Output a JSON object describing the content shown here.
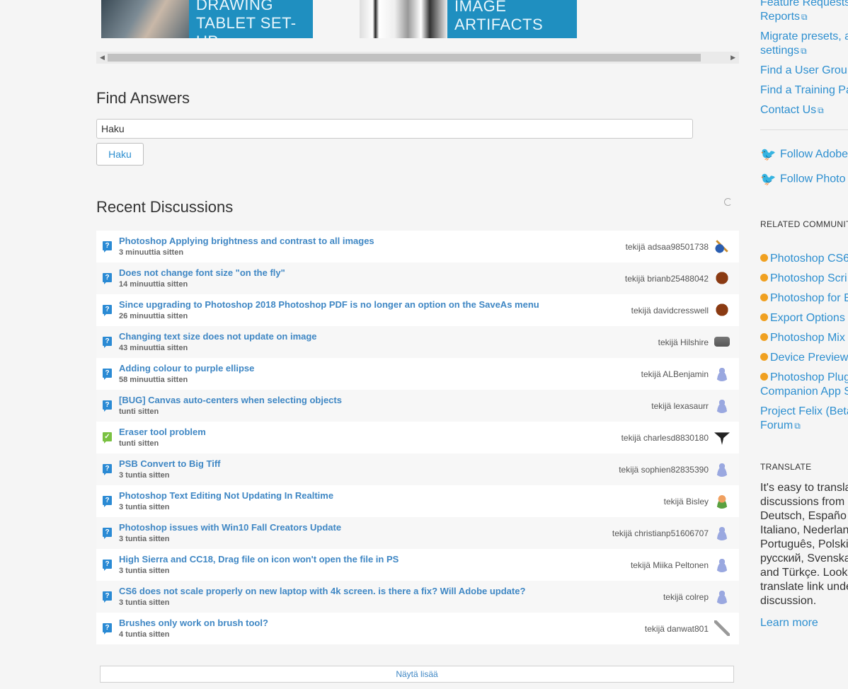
{
  "carousel": {
    "items": [
      {
        "line1": "DRAWING",
        "line2": "TABLET SET-UP"
      },
      {
        "line1": "IMAGE",
        "line2": "ARTIFACTS"
      }
    ]
  },
  "find": {
    "title": "Find Answers",
    "input_value": "Haku",
    "button_label": "Haku"
  },
  "recent": {
    "title": "Recent Discussions",
    "items": [
      {
        "title": "Photoshop Applying brightness and contrast to all images",
        "time": "3 minuuttia sitten",
        "author": "tekijä adsaa98501738",
        "avatar": "guitar-avatar",
        "status": "question"
      },
      {
        "title": "Does not change font size \"on the fly\"",
        "time": "14 minuuttia sitten",
        "author": "tekijä brianb25488042",
        "avatar": "football-avatar",
        "status": "question"
      },
      {
        "title": "Since upgrading to Photoshop 2018 Photoshop PDF is no longer an option on the SaveAs menu",
        "time": "26 minuuttia sitten",
        "author": "tekijä davidcresswell",
        "avatar": "football-avatar",
        "status": "question"
      },
      {
        "title": "Changing text size does not update on image",
        "time": "43 minuuttia sitten",
        "author": "tekijä Hilshire",
        "avatar": "camera-avatar",
        "status": "question"
      },
      {
        "title": "Adding colour to purple ellipse",
        "time": "58 minuuttia sitten",
        "author": "tekijä ALBenjamin",
        "avatar": "person-avatar",
        "status": "question"
      },
      {
        "title": "[BUG] Canvas auto-centers when selecting objects",
        "time": "tunti sitten",
        "author": "tekijä lexasaurr",
        "avatar": "person-avatar",
        "status": "question"
      },
      {
        "title": "Eraser tool problem",
        "time": "tunti sitten",
        "author": "tekijä charlesd8830180",
        "avatar": "graduation-cap-avatar",
        "status": "answered"
      },
      {
        "title": "PSB Convert to Big Tiff",
        "time": "3 tuntia sitten",
        "author": "tekijä sophien82835390",
        "avatar": "person-avatar",
        "status": "question"
      },
      {
        "title": "Photoshop Text Editing Not Updating In Realtime",
        "time": "3 tuntia sitten",
        "author": "tekijä Bisley",
        "avatar": "head-avatar",
        "status": "question"
      },
      {
        "title": "Photoshop issues with Win10 Fall Creators Update",
        "time": "3 tuntia sitten",
        "author": "tekijä christianp51606707",
        "avatar": "person-avatar",
        "status": "question"
      },
      {
        "title": "High Sierra and CC18, Drag file on icon won't open the file in PS",
        "time": "3 tuntia sitten",
        "author": "tekijä Miika Peltonen",
        "avatar": "person-avatar",
        "status": "question"
      },
      {
        "title": "CS6 does not scale properly on new laptop with 4k screen. is there a fix? Will Adobe update?",
        "time": "3 tuntia sitten",
        "author": "tekijä colrep",
        "avatar": "person-avatar",
        "status": "question"
      },
      {
        "title": "Brushes only work on brush tool?",
        "time": "4 tuntia sitten",
        "author": "tekijä danwat801",
        "avatar": "wrench-avatar",
        "status": "question"
      }
    ],
    "more_label": "Näytä lisää"
  },
  "sidebar": {
    "links": [
      {
        "text": "Feature Requests"
      },
      {
        "text": "Reports"
      },
      {
        "text": "Migrate presets, a"
      },
      {
        "text": "settings"
      },
      {
        "text": "Find a User Grou"
      },
      {
        "text": "Find a Training Pa"
      },
      {
        "text": "Contact Us"
      }
    ],
    "twitter": [
      {
        "text": "Follow Adobe"
      },
      {
        "text": "Follow Photo"
      }
    ],
    "related_heading": "RELATED COMMUNIT",
    "related": [
      {
        "text": "Photoshop CS6"
      },
      {
        "text": "Photoshop Scri"
      },
      {
        "text": "Photoshop for E"
      },
      {
        "text": "Export Options"
      },
      {
        "text": "Photoshop Mix"
      },
      {
        "text": "Device Preview"
      },
      {
        "text": "Photoshop Plug"
      },
      {
        "text": "Companion App S"
      },
      {
        "text": "Project Felix (Beta"
      },
      {
        "text": "Forum"
      }
    ],
    "translate_heading": "TRANSLATE",
    "translate_text": "It's easy to transla\ndiscussions from\nDeutsch, Españo\nItaliano, Nederlan\nPortuguês, Polski\nрусский, Svenska\nand Türkçe. Look\ntranslate link unde\ndiscussion.",
    "learn_more": "Learn more"
  },
  "colors": {
    "link": "#3f87c4",
    "accent": "#2d8fd0",
    "banner": "#1f8fc0",
    "answered": "#7ac142"
  }
}
